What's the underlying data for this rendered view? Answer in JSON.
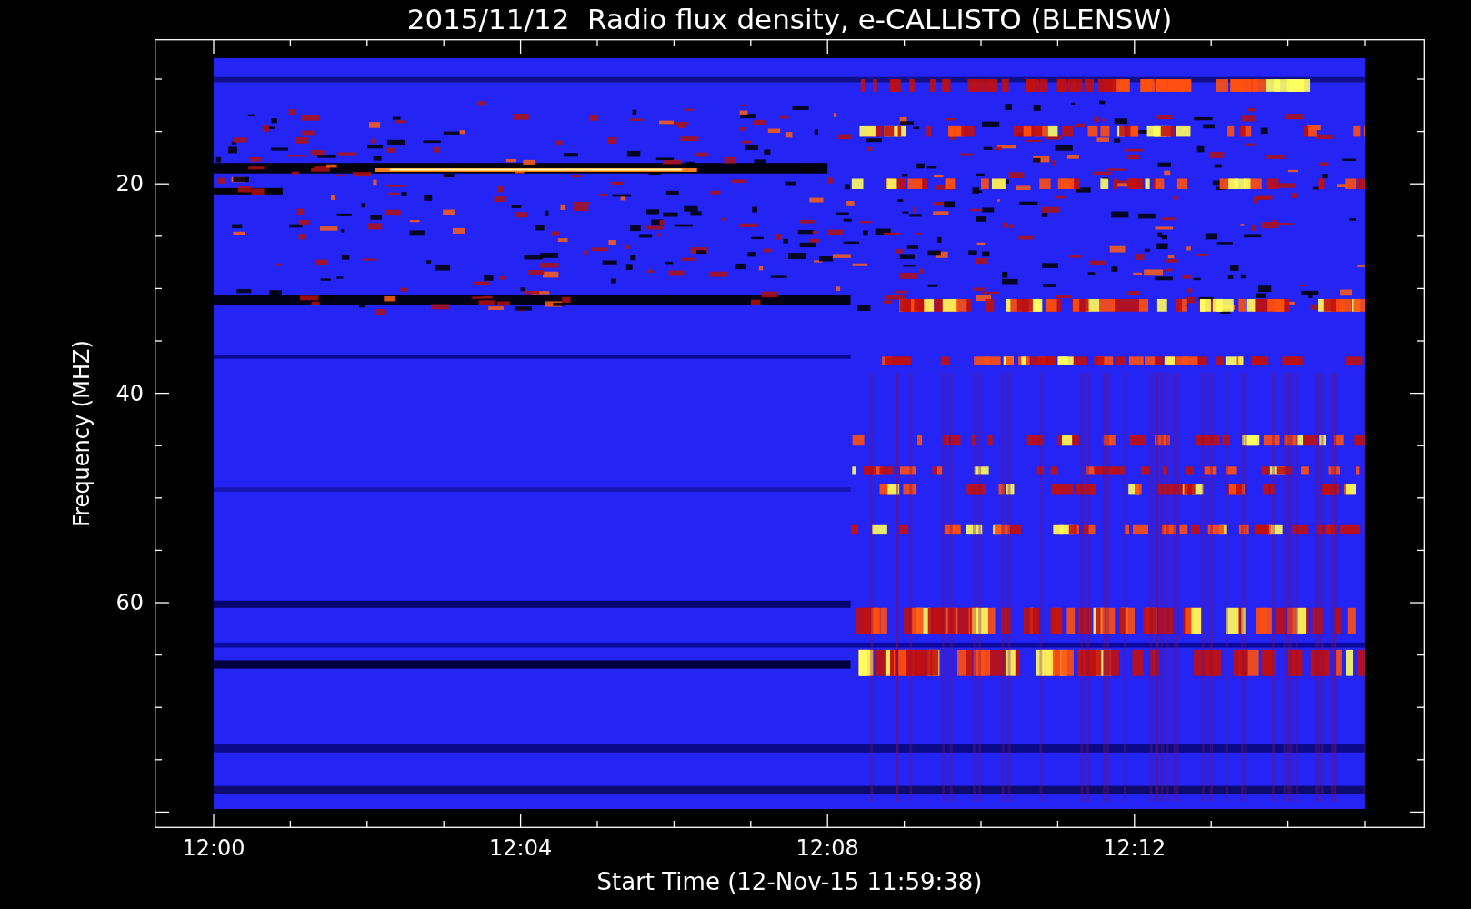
{
  "title": "2015/11/12  Radio flux density, e-CALLISTO (BLENSW)",
  "y_axis": {
    "label": "Frequency (MHZ)",
    "ticks": [
      "20",
      "40",
      "60"
    ]
  },
  "x_axis": {
    "label": "Start Time (12-Nov-15 11:59:38)",
    "ticks": [
      "12:00",
      "12:04",
      "12:08",
      "12:12"
    ]
  }
}
